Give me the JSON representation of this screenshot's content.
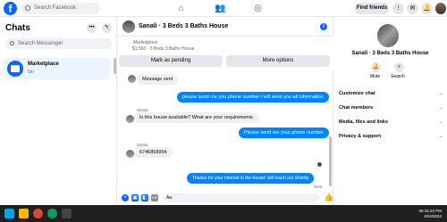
{
  "topbar": {
    "search_placeholder": "Search Facebook",
    "find_friends": "Find friends"
  },
  "left": {
    "title": "Chats",
    "search_placeholder": "Search Messenger",
    "items": [
      {
        "name": "Marketplace",
        "time": "5m"
      }
    ]
  },
  "chat": {
    "title": "Sanali · 3 Beds 3 Baths House",
    "listing_label": "Marketplace",
    "listing_price": "$1,550 · 3 Beds 3 Baths House",
    "mark_pending": "Mark as pending",
    "more_options": "More options",
    "messages": [
      {
        "dir": "in",
        "text": "Message sent"
      },
      {
        "dir": "out",
        "text": "please send me you phone number i will send you all information"
      },
      {
        "dir": "in",
        "sender": "Sanali",
        "text": "Is this house available? What are your requirements"
      },
      {
        "dir": "out",
        "text": "Please send me your phone number"
      },
      {
        "dir": "in",
        "sender": "Sanali",
        "text": "6746858954"
      },
      {
        "dir": "out",
        "text": "Thanks for your interest in the house! will reach out Shortly",
        "status": "Sent"
      }
    ],
    "input_value": "Aa"
  },
  "right": {
    "name": "Sanali · 3 Beds 3 Baths House",
    "mute": "Mute",
    "search": "Search",
    "sections": [
      "Customize chat",
      "Chat members",
      "Media, files and links",
      "Privacy & support"
    ]
  },
  "taskbar": {
    "time": "05:15:22 PM",
    "date": "10/4/2024"
  },
  "colors": {
    "accent": "#0866ff",
    "bubble_out": "#0084ff"
  }
}
